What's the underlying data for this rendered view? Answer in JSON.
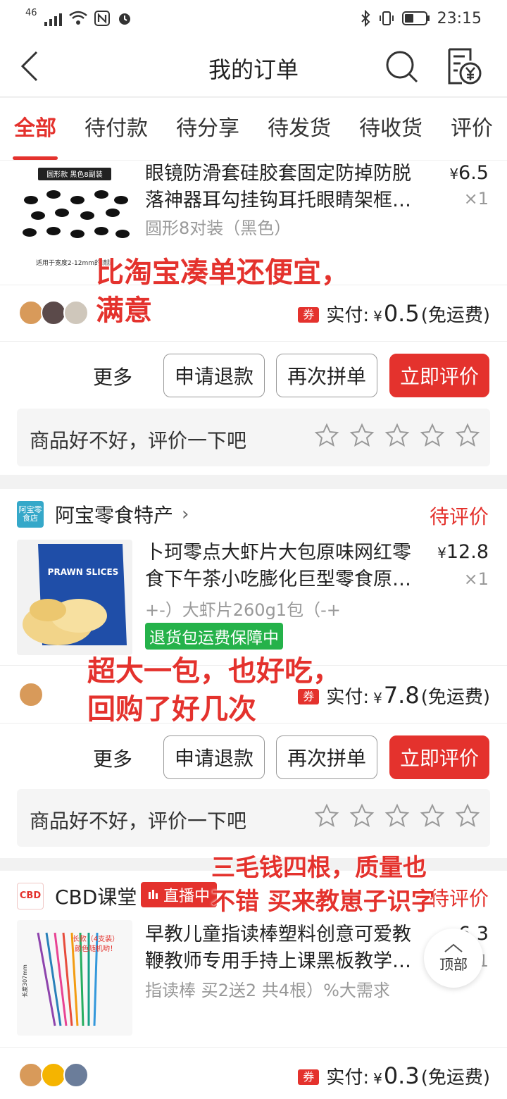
{
  "status_bar": {
    "network": "46",
    "time": "23:15"
  },
  "header": {
    "title": "我的订单"
  },
  "tabs": [
    "全部",
    "待付款",
    "待分享",
    "待发货",
    "待收货",
    "评价"
  ],
  "orders": [
    {
      "product": {
        "title": "眼镜防滑套硅胶套固定防掉防脱落神器耳勾挂钩耳托眼睛架框…",
        "spec": "圆形8对装（黑色）",
        "price": "6.5",
        "qty": "×1",
        "image_text": {
          "top": "圆形款 黑色8副装",
          "bottom": "适用于宽度2-12mm的镜腿"
        }
      },
      "pay": {
        "label": "实付:",
        "amount": "0.5",
        "note": "(免运费)"
      },
      "coupon": "券",
      "actions": {
        "more": "更多",
        "refund": "申请退款",
        "again": "再次拼单",
        "rate": "立即评价"
      },
      "review_prompt": "商品好不好，评价一下吧",
      "overlay": [
        "比淘宝凑单还便宜，",
        "满意"
      ]
    },
    {
      "shop": {
        "logo_text": "阿宝零食店",
        "name": "阿宝零食特产"
      },
      "status": "待评价",
      "product": {
        "title": "卜珂零点大虾片大包原味网红零食下午茶小吃膨化巨型零食原…",
        "spec": "+-）大虾片260g1包（-+",
        "price": "12.8",
        "qty": "×1",
        "badge": "退货包运费保障中",
        "image_text": {
          "label": "PRAWN SLICES"
        }
      },
      "pay": {
        "label": "实付:",
        "amount": "7.8",
        "note": "(免运费)"
      },
      "coupon": "券",
      "actions": {
        "more": "更多",
        "refund": "申请退款",
        "again": "再次拼单",
        "rate": "立即评价"
      },
      "review_prompt": "商品好不好，评价一下吧",
      "overlay": [
        "超大一包，也好吃，",
        "回购了好几次"
      ]
    },
    {
      "shop": {
        "logo_text": "CBD",
        "name": "CBD课堂",
        "live": "直播中"
      },
      "status": "待评价",
      "product": {
        "title": "早教儿童指读棒塑料创意可爱教鞭教师专用手持上课黑板教学…",
        "spec": "指读棒 买2送2 共4根）%大需求",
        "price": "6.3",
        "qty": "×1",
        "image_text": {
          "note1": "长款（4支装）",
          "note2": "颜色随机哟！",
          "length": "长度307mm"
        }
      },
      "pay": {
        "label": "实付:",
        "amount": "0.3",
        "note": "(免运费)"
      },
      "coupon": "券",
      "overlay": [
        "三毛钱四根，质量也",
        "不错  买来教崽子识字"
      ]
    }
  ],
  "back_to_top": "顶部",
  "colors": {
    "accent": "#e4322d",
    "green": "#25b24a"
  }
}
